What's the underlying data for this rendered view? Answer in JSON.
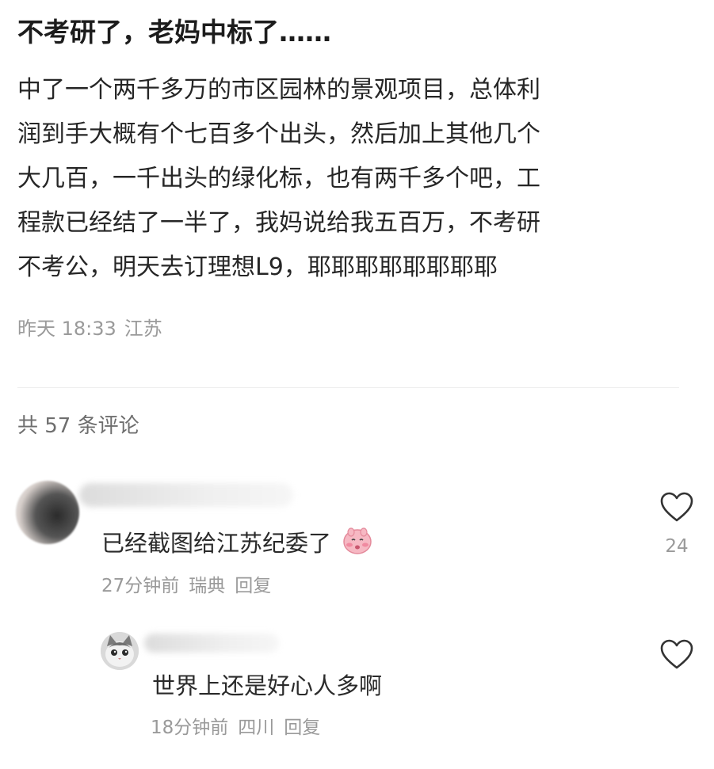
{
  "post": {
    "title": "不考研了，老妈中标了……",
    "body_lines": [
      "中了一个两千多万的市区园林的景观项目，总体利",
      "润到手大概有个七百多个出头，然后加上其他几个",
      "大几百，一千出头的绿化标，也有两千多个吧，工",
      "程款已经结了一半了，我妈说给我五百万，不考研",
      "不考公，明天去订理想L9，耶耶耶耶耶耶耶耶"
    ],
    "time": "昨天 18:33",
    "location": "江苏"
  },
  "comments_header": {
    "count_label": "共 57 条评论"
  },
  "comments": [
    {
      "text": "已经截图给江苏纪委了",
      "emoji_icon": "pink-blushing-face-emoji",
      "time": "27分钟前",
      "location": "瑞典",
      "reply_label": "回复",
      "like_count": "24",
      "like_icon": "heart-outline-icon"
    },
    {
      "text": "世界上还是好心人多啊",
      "time": "18分钟前",
      "location": "四川",
      "reply_label": "回复",
      "like_icon": "heart-outline-icon",
      "avatar_icon": "cat-avatar"
    }
  ],
  "colors": {
    "text_primary": "#1f1f1f",
    "text_secondary": "#9a9a9a",
    "divider": "#ededed",
    "emoji_pink": "#f4a7b4"
  }
}
